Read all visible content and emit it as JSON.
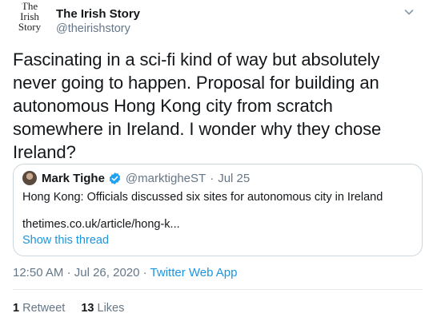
{
  "account": {
    "avatar_text": [
      "The",
      "Irish",
      "Story"
    ],
    "display_name": "The Irish Story",
    "handle": "@theirishstory"
  },
  "tweet_text": "Fascinating in a sci-fi kind of way but absolutely never going to happen. Proposal for building an autonomous Hong Kong city from scratch somewhere in Ireland. I wonder why they chose Ireland?",
  "quoted": {
    "name": "Mark Tighe",
    "handle": "@marktigheST",
    "separator": "·",
    "date": "Jul 25",
    "text": "Hong Kong: Officials discussed six sites for autonomous city in Ireland",
    "link": "thetimes.co.uk/article/hong-k...",
    "show_thread": "Show this thread"
  },
  "meta": {
    "time": "12:50 AM",
    "sep1": "·",
    "date": "Jul 26, 2020",
    "sep2": "·",
    "app": "Twitter Web App"
  },
  "stats": {
    "retweets_count": "1",
    "retweets_label": "Retweet",
    "likes_count": "13",
    "likes_label": "Likes"
  },
  "colors": {
    "link": "#1b95e0",
    "secondary_text": "#657786",
    "border": "#ccd6dd"
  },
  "icons": {
    "caret": "chevron-down-icon",
    "verified": "verified-badge-icon"
  }
}
